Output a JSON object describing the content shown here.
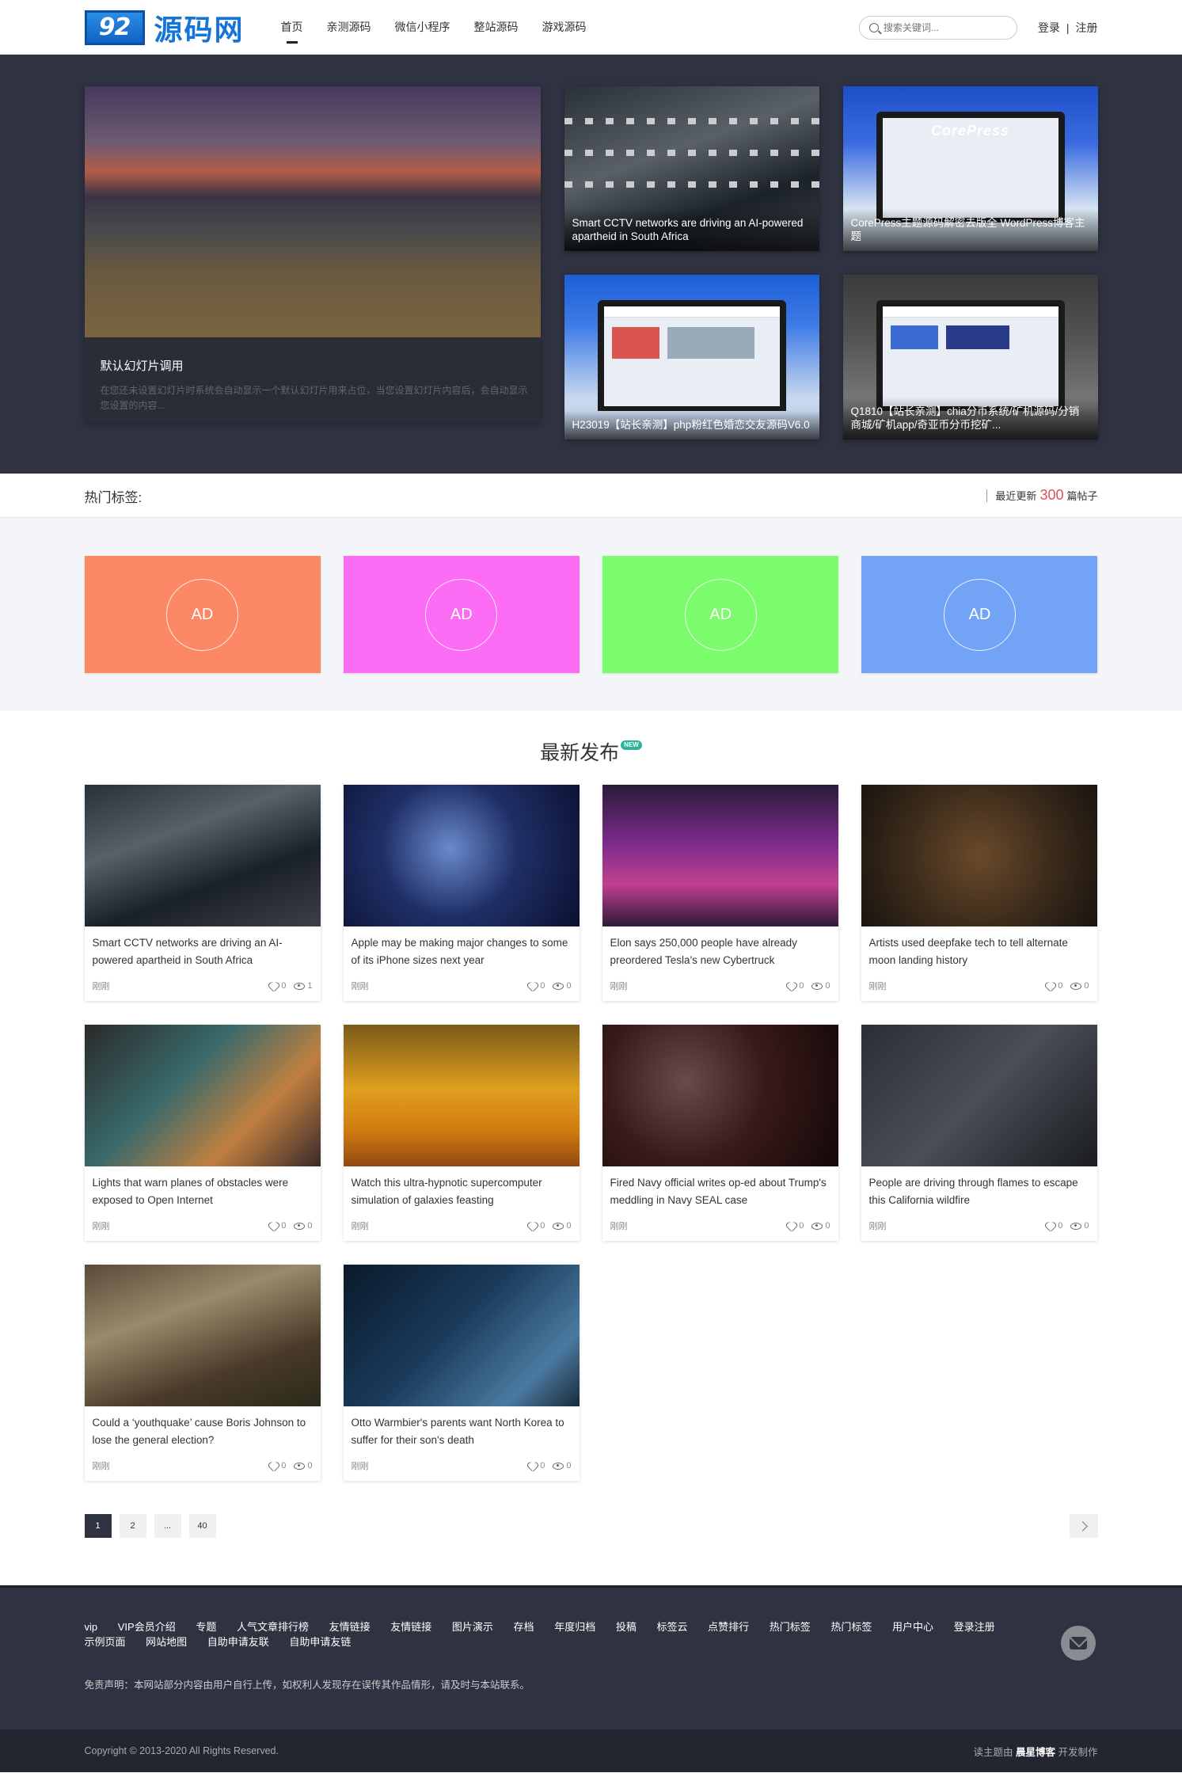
{
  "header": {
    "logo_badge": "92",
    "logo_text": "源码网",
    "nav": [
      "首页",
      "亲测源码",
      "微信小程序",
      "整站源码",
      "游戏源码"
    ],
    "search_placeholder": "搜索关键词...",
    "login": "登录",
    "register": "注册",
    "sep": "|"
  },
  "hero": {
    "main_title": "默认幻灯片调用",
    "main_desc": "在您还未设置幻灯片时系统会自动显示一个默认幻灯片用来占位，当您设置幻灯片内容后，会自动显示您设置的内容...",
    "cards": [
      "Smart CCTV networks are driving an AI-powered apartheid in South Africa",
      "CorePress主题源码解密去版全 WordPress博客主题",
      "H23019【站长亲测】php粉红色婚恋交友源码V6.0",
      "Q1810【站长亲测】chia分币系统/矿机源码/分销商城/矿机app/奇亚币分币挖矿..."
    ],
    "brand": "CorePress"
  },
  "tags": {
    "label": "热门标签:",
    "recent_prefix": "最近更新",
    "recent_count": "300",
    "recent_suffix": "篇帖子"
  },
  "ads": [
    {
      "label": "AD",
      "color": "#fc8866"
    },
    {
      "label": "AD",
      "color": "#fc6cf5"
    },
    {
      "label": "AD",
      "color": "#7bfc6c"
    },
    {
      "label": "AD",
      "color": "#73a3f5"
    }
  ],
  "latest": {
    "title": "最新发布",
    "badge": "NEW",
    "posts": [
      {
        "title": "Smart CCTV networks are driving an AI-powered apartheid in South Africa",
        "time": "刚刚",
        "likes": "0",
        "views": "1"
      },
      {
        "title": "Apple may be making major changes to some of its iPhone sizes next year",
        "time": "刚刚",
        "likes": "0",
        "views": "0"
      },
      {
        "title": "Elon says 250,000 people have already preordered Tesla's new Cybertruck",
        "time": "刚刚",
        "likes": "0",
        "views": "0"
      },
      {
        "title": "Artists used deepfake tech to tell alternate moon landing history",
        "time": "刚刚",
        "likes": "0",
        "views": "0"
      },
      {
        "title": "Lights that warn planes of obstacles were exposed to Open Internet",
        "time": "刚刚",
        "likes": "0",
        "views": "0"
      },
      {
        "title": "Watch this ultra-hypnotic supercomputer simulation of galaxies feasting",
        "time": "刚刚",
        "likes": "0",
        "views": "0"
      },
      {
        "title": "Fired Navy official writes op-ed about Trump's meddling in Navy SEAL case",
        "time": "刚刚",
        "likes": "0",
        "views": "0"
      },
      {
        "title": "People are driving through flames to escape this California wildfire",
        "time": "刚刚",
        "likes": "0",
        "views": "0"
      },
      {
        "title": "Could a ‘youthquake’ cause Boris Johnson to lose the general election?",
        "time": "刚刚",
        "likes": "0",
        "views": "0"
      },
      {
        "title": "Otto Warmbier's parents want North Korea to suffer for their son's death",
        "time": "刚刚",
        "likes": "0",
        "views": "0"
      }
    ]
  },
  "pager": [
    "1",
    "2",
    "...",
    "40"
  ],
  "footer": {
    "links": [
      "vip",
      "VIP会员介绍",
      "专题",
      "人气文章排行榜",
      "友情链接",
      "友情链接",
      "图片演示",
      "存档",
      "年度归档",
      "投稿",
      "标签云",
      "点赞排行",
      "热门标签",
      "热门标签",
      "用户中心",
      "登录注册",
      "示例页面",
      "网站地图",
      "自助申请友联",
      "自助申请友链"
    ],
    "disclaimer": "免责声明：本网站部分内容由用户自行上传，如权利人发现存在误传其作品情形，请及时与本站联系。",
    "copyright": "Copyright © 2013-2020 All Rights Reserved.",
    "theme_prefix": "读主题由",
    "theme_author": "晨星博客",
    "theme_suffix": "开发制作"
  }
}
